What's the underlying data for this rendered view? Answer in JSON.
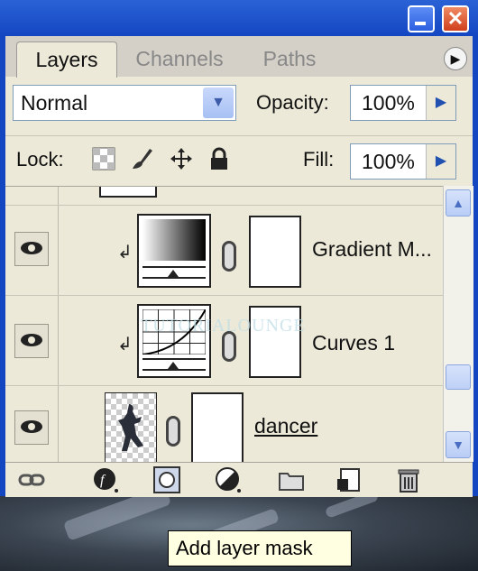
{
  "panel": {
    "tabs": [
      {
        "label": "Layers"
      },
      {
        "label": "Channels"
      },
      {
        "label": "Paths"
      }
    ],
    "blend_mode": "Normal",
    "opacity_label": "Opacity:",
    "opacity_value": "100%",
    "lock_label": "Lock:",
    "fill_label": "Fill:",
    "fill_value": "100%"
  },
  "layers": [
    {
      "name": "Gradient M...",
      "type": "gradient-map-adjustment",
      "visible": true,
      "clipped": true
    },
    {
      "name": "Curves 1",
      "type": "curves-adjustment",
      "visible": true,
      "clipped": true
    },
    {
      "name": "dancer",
      "type": "pixel-layer",
      "visible": true,
      "clipped": false
    }
  ],
  "watermark": "TUTORIALOUNGE",
  "tooltip": "Add layer mask",
  "icons": {
    "lock": [
      "lock-transparent-icon",
      "lock-brush-icon",
      "lock-move-icon",
      "lock-all-icon"
    ],
    "toolbar": [
      "link-layers-icon",
      "layer-style-icon",
      "add-layer-mask-icon",
      "adjustment-layer-icon",
      "new-group-icon",
      "new-layer-icon",
      "trash-icon"
    ]
  },
  "colors": {
    "title_bar": "#1446c2",
    "panel_bg": "#ece9d8",
    "accent": "#2050b0"
  }
}
